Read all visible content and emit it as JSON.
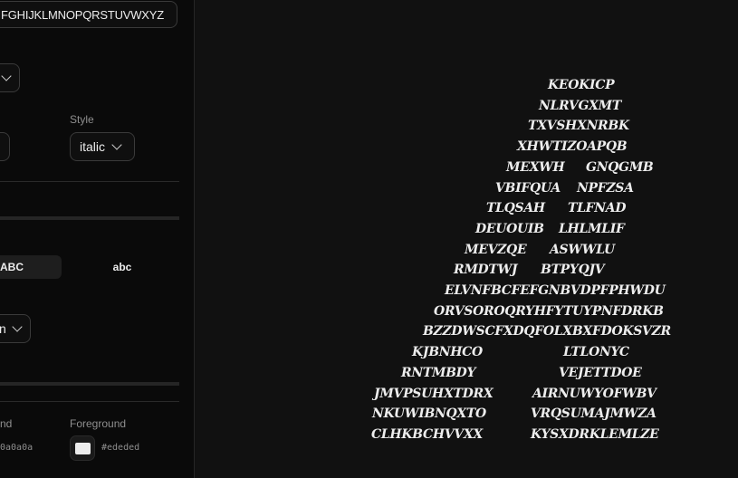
{
  "sidebar": {
    "text_input_value": "FGHIJKLMNOPQRSTUVWXYZ",
    "style_label": "Style",
    "style_value": "italic",
    "case_options": [
      "ABC",
      "abc"
    ],
    "bottom_select_value": "n",
    "background_label": "nd",
    "background_hex": "0a0a0a",
    "foreground_label": "Foreground",
    "foreground_hex": "#ededed"
  },
  "canvas": {
    "art_lines": [
      {
        "left": "KEOKICP",
        "right": ""
      },
      {
        "left": "NLRVGXMT",
        "right": ""
      },
      {
        "left": "TXVSHXNRBK",
        "right": ""
      },
      {
        "left": "XHWTIZOAPQB",
        "right": ""
      },
      {
        "left": "MEXWH",
        "right": "GNQGMB"
      },
      {
        "left": "VBIFQUA",
        "right": "NPFZSA"
      },
      {
        "left": "TLQSAH",
        "right": "TLFNAD"
      },
      {
        "left": "DEUOUIB",
        "right": "LHLMLIF"
      },
      {
        "left": "MEVZQE",
        "right": "ASWWLU"
      },
      {
        "left": "RMDTWJ",
        "right": "BTPYQJV"
      },
      {
        "left": "ELVNFBCFEFGNBVDPFPHWDU",
        "right": ""
      },
      {
        "left": "ORVSOROQRYHFYTUYPNFDRKB",
        "right": ""
      },
      {
        "left": "BZZDWSCFXDQFOLXBXFDOKSVZR",
        "right": ""
      },
      {
        "left": "KJBNHCO",
        "right": "LTLONYC"
      },
      {
        "left": "RNTMBDY",
        "right": "VEJETTDOE"
      },
      {
        "left": "JMVPSUHXTDRX",
        "right": "AIRNUWYOFWBV"
      },
      {
        "left": "NKUWIBNQXTO",
        "right": "VRQSUMAJMWZA"
      },
      {
        "left": "CLHKBCHVVXX",
        "right": "KYSXDRKLEMLZE"
      }
    ]
  }
}
